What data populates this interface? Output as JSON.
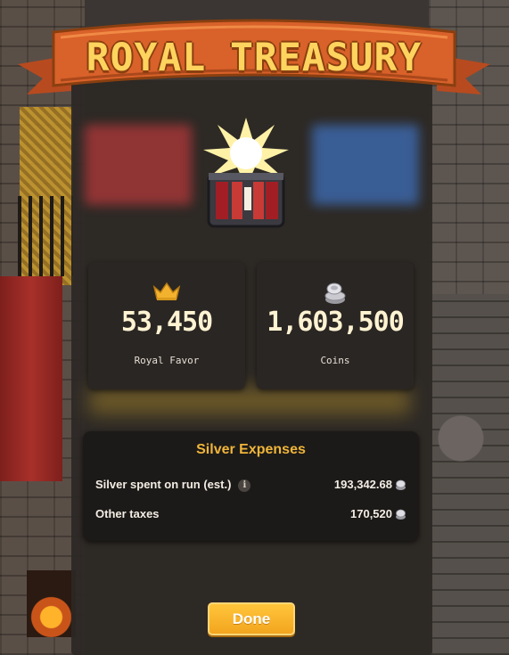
{
  "banner": {
    "title": "ROYAL TREASURY"
  },
  "stats": {
    "favor": {
      "value": "53,450",
      "label": "Royal Favor",
      "icon": "crown-icon"
    },
    "coins": {
      "value": "1,603,500",
      "label": "Coins",
      "icon": "silver-coins-icon"
    }
  },
  "expenses": {
    "title": "Silver Expenses",
    "rows": [
      {
        "label": "Silver spent on run (est.)",
        "value": "193,342.68",
        "has_info": true
      },
      {
        "label": "Other taxes",
        "value": "170,520",
        "has_info": false
      }
    ],
    "info_glyph": "i"
  },
  "actions": {
    "done_label": "Done"
  },
  "colors": {
    "banner_text": "#ffd45e",
    "banner_ribbon": "#d9612a",
    "expense_title": "#f0b53a",
    "button": "#ffc53b",
    "card_bg": "#2a2623",
    "panel_bg": "#2c2825"
  }
}
